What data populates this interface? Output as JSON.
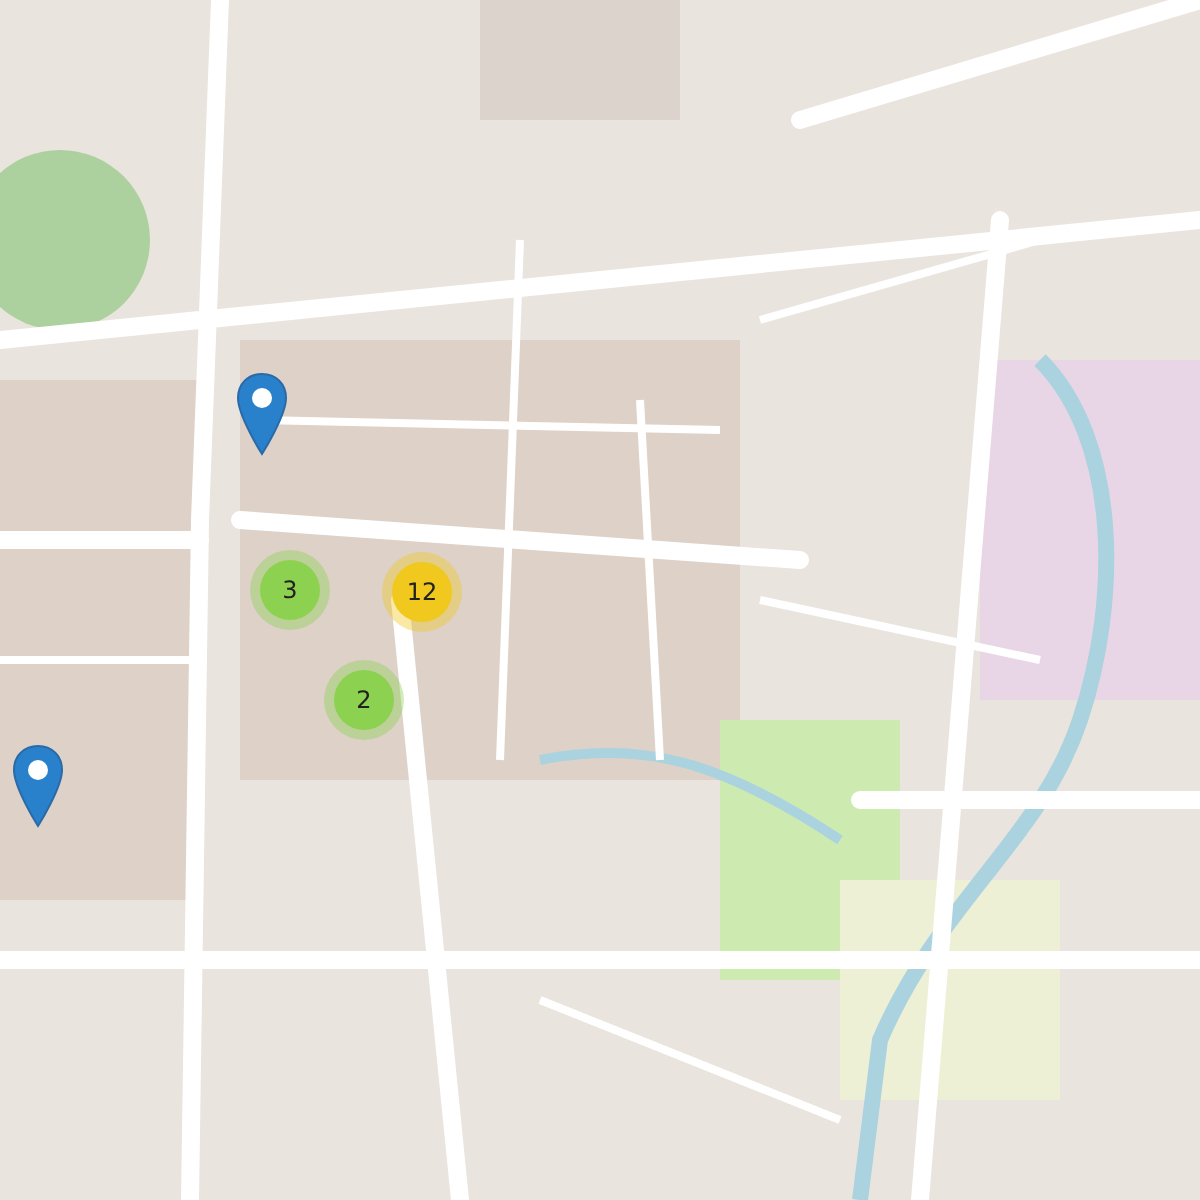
{
  "map": {
    "clusters": [
      {
        "count": "3",
        "color": "#8cd250"
      },
      {
        "count": "12",
        "color": "#f0c81e"
      },
      {
        "count": "2",
        "color": "#8cd250"
      }
    ],
    "pins": [
      {
        "kind": "location"
      },
      {
        "kind": "location"
      }
    ]
  }
}
